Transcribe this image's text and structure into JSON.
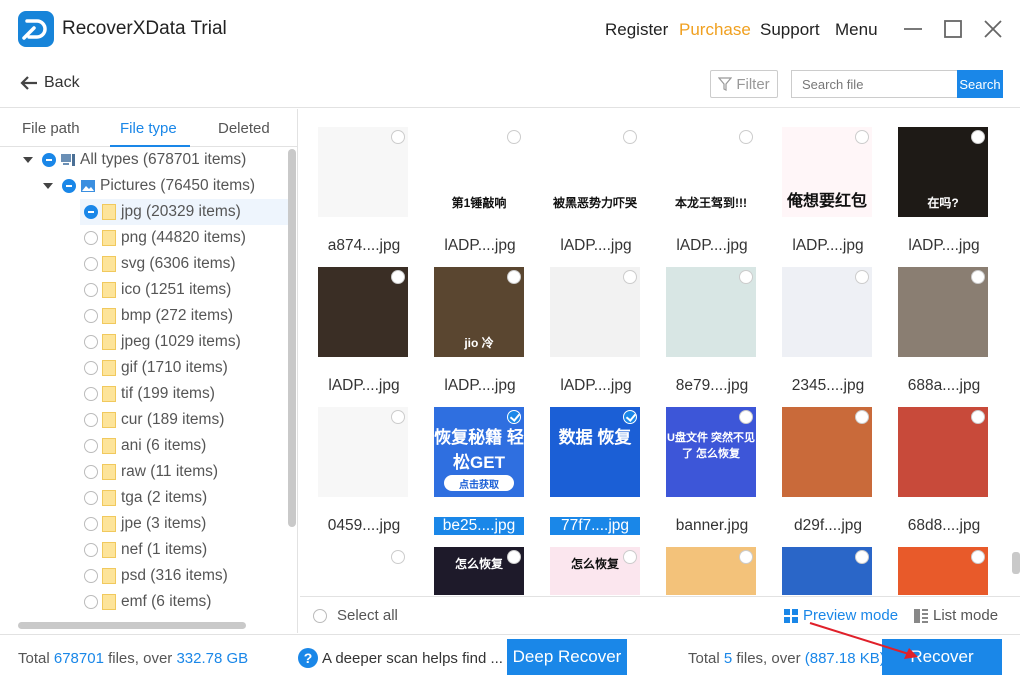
{
  "app": {
    "title": "RecoverXData Trial"
  },
  "topnav": {
    "register": "Register",
    "purchase": "Purchase",
    "support": "Support",
    "menu": "Menu"
  },
  "toolbar": {
    "back_label": "Back",
    "filter_label": "Filter",
    "search_placeholder": "Search file",
    "search_button": "Search"
  },
  "tabs": {
    "file_path": "File path",
    "file_type": "File type",
    "deleted": "Deleted",
    "active": "File type"
  },
  "tree": {
    "root": "All types (678701 items)",
    "pictures": "Pictures (76450 items)",
    "items": [
      "jpg (20329 items)",
      "png (44820 items)",
      "svg (6306 items)",
      "ico (1251 items)",
      "bmp (272 items)",
      "jpeg (1029 items)",
      "gif (1710 items)",
      "tif (199 items)",
      "cur (189 items)",
      "ani (6 items)",
      "raw (11 items)",
      "tga (2 items)",
      "jpe (3 items)",
      "nef (1 items)",
      "psd (316 items)",
      "emf (6 items)"
    ]
  },
  "files": [
    {
      "name": "a874....jpg",
      "selected": false
    },
    {
      "name": "lADP....jpg",
      "selected": false,
      "caption": "第1锤敲响"
    },
    {
      "name": "lADP....jpg",
      "selected": false,
      "caption": "被黑恶势力吓哭"
    },
    {
      "name": "lADP....jpg",
      "selected": false,
      "caption": "本龙王驾到!!!"
    },
    {
      "name": "lADP....jpg",
      "selected": false,
      "caption": "俺想要红包"
    },
    {
      "name": "lADP....jpg",
      "selected": false,
      "caption": "在吗?"
    },
    {
      "name": "lADP....jpg",
      "selected": false
    },
    {
      "name": "lADP....jpg",
      "selected": false,
      "caption": "jio 冷"
    },
    {
      "name": "lADP....jpg",
      "selected": false
    },
    {
      "name": "8e79....jpg",
      "selected": false
    },
    {
      "name": "2345....jpg",
      "selected": false
    },
    {
      "name": "688a....jpg",
      "selected": false
    },
    {
      "name": "0459....jpg",
      "selected": false
    },
    {
      "name": "be25....jpg",
      "selected": true,
      "caption": "恢复秘籍 轻松GET",
      "caption2": "点击获取"
    },
    {
      "name": "77f7....jpg",
      "selected": true,
      "caption": "数据 恢复"
    },
    {
      "name": "banner.jpg",
      "selected": false,
      "caption": "U盘文件 突然不见了 怎么恢复"
    },
    {
      "name": "d29f....jpg",
      "selected": false
    },
    {
      "name": "68d8....jpg",
      "selected": false
    },
    {
      "name": "",
      "selected": false
    },
    {
      "name": "",
      "selected": false,
      "caption": "怎么恢复"
    },
    {
      "name": "",
      "selected": false,
      "caption": "怎么恢复"
    },
    {
      "name": "",
      "selected": false
    },
    {
      "name": "",
      "selected": false
    },
    {
      "name": "",
      "selected": false
    }
  ],
  "grid_footer": {
    "select_all": "Select all",
    "preview_mode": "Preview mode",
    "list_mode": "List mode"
  },
  "bottom": {
    "total_prefix": "Total ",
    "total_files": "678701",
    "files_over": " files, over ",
    "total_size": "332.78 GB",
    "help_text": "A deeper scan helps find ...",
    "deep_recover": "Deep Recover",
    "sel_prefix": "Total ",
    "sel_files": "5",
    "sel_over": " files, over ",
    "sel_size": "(887.18 KB)",
    "recover": "Recover"
  },
  "colors": {
    "accent": "#1a87e8",
    "purchase": "#f0a020",
    "annotation_arrow": "#e0202a"
  }
}
